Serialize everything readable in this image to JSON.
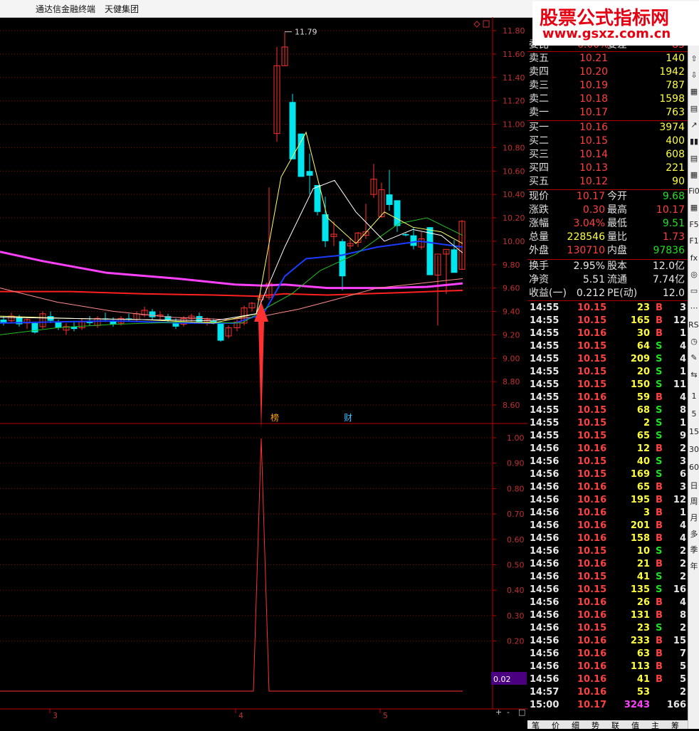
{
  "window": {
    "app_title": "通达信金融终端",
    "stock_name": "天健集团"
  },
  "watermark": {
    "line1": "股票公式指标网",
    "line2": "www.gsxz.com.cn"
  },
  "chart": {
    "high_marker": "11.79",
    "price_axis": [
      "11.80",
      "11.60",
      "11.40",
      "11.20",
      "11.00",
      "10.80",
      "10.60",
      "10.40",
      "10.20",
      "10.00",
      "9.80",
      "9.60",
      "9.40",
      "9.20",
      "9.00",
      "8.80",
      "8.60"
    ],
    "indicator_axis": [
      "1.00",
      "0.90",
      "0.80",
      "0.70",
      "0.60",
      "0.50",
      "0.40",
      "0.30",
      "0.20"
    ],
    "indicator_value": "0.02",
    "event_marks": [
      "榜",
      "财"
    ],
    "date_labels": [
      "3",
      "4",
      "5"
    ],
    "zoom_buttons": [
      "+",
      "-",
      "□"
    ],
    "colors": {
      "up": "#ff3030",
      "down": "#00e5ee",
      "grid": "#8b0000",
      "ma_long": "#ff40ff",
      "ma_blue": "#1a3cff"
    }
  },
  "quote": {
    "header_label": "委比",
    "header_value": "6.00%",
    "header_label2": "委差",
    "header_value2": "85",
    "asks": [
      {
        "label": "卖五",
        "price": "10.21",
        "vol": "140"
      },
      {
        "label": "卖四",
        "price": "10.20",
        "vol": "1942"
      },
      {
        "label": "卖三",
        "price": "10.19",
        "vol": "787"
      },
      {
        "label": "卖二",
        "price": "10.18",
        "vol": "1598"
      },
      {
        "label": "卖一",
        "price": "10.17",
        "vol": "763"
      }
    ],
    "bids": [
      {
        "label": "买一",
        "price": "10.16",
        "vol": "3974"
      },
      {
        "label": "买二",
        "price": "10.15",
        "vol": "400"
      },
      {
        "label": "买三",
        "price": "10.14",
        "vol": "608"
      },
      {
        "label": "买四",
        "price": "10.13",
        "vol": "221"
      },
      {
        "label": "买五",
        "price": "10.12",
        "vol": "90"
      }
    ],
    "stats": [
      {
        "l1": "现价",
        "v1": "10.17",
        "c1": "red",
        "l2": "今开",
        "v2": "9.68",
        "c2": "grn"
      },
      {
        "l1": "涨跌",
        "v1": "0.30",
        "c1": "red",
        "l2": "最高",
        "v2": "10.17",
        "c2": "red"
      },
      {
        "l1": "涨幅",
        "v1": "3.04%",
        "c1": "red",
        "l2": "最低",
        "v2": "9.51",
        "c2": "grn"
      },
      {
        "l1": "总量",
        "v1": "228546",
        "c1": "yel",
        "l2": "量比",
        "v2": "1.73",
        "c2": "red"
      },
      {
        "l1": "外盘",
        "v1": "130710",
        "c1": "red",
        "l2": "内盘",
        "v2": "97836",
        "c2": "grn"
      }
    ],
    "stats2": [
      {
        "l1": "换手",
        "v1": "2.95%",
        "l2": "股本",
        "v2": "12.0亿"
      },
      {
        "l1": "净资",
        "v1": "5.51",
        "l2": "流通",
        "v2": "7.74亿"
      },
      {
        "l1": "收益(一)",
        "v1": "0.212",
        "l2": "PE(动)",
        "v2": "12.0"
      }
    ],
    "ticks": [
      {
        "t": "14:55",
        "p": "10.15",
        "v": "23",
        "d": "B",
        "n": "3",
        "pc": "red"
      },
      {
        "t": "14:55",
        "p": "10.15",
        "v": "165",
        "d": "B",
        "n": "12",
        "pc": "red"
      },
      {
        "t": "14:55",
        "p": "10.16",
        "v": "30",
        "d": "B",
        "n": "1",
        "pc": "red"
      },
      {
        "t": "14:55",
        "p": "10.15",
        "v": "64",
        "d": "S",
        "n": "4",
        "pc": "red"
      },
      {
        "t": "14:55",
        "p": "10.15",
        "v": "209",
        "d": "S",
        "n": "4",
        "pc": "red"
      },
      {
        "t": "14:55",
        "p": "10.15",
        "v": "20",
        "d": "S",
        "n": "1",
        "pc": "red"
      },
      {
        "t": "14:55",
        "p": "10.15",
        "v": "150",
        "d": "S",
        "n": "11",
        "pc": "red"
      },
      {
        "t": "14:55",
        "p": "10.16",
        "v": "59",
        "d": "B",
        "n": "4",
        "pc": "red"
      },
      {
        "t": "14:55",
        "p": "10.15",
        "v": "68",
        "d": "S",
        "n": "8",
        "pc": "red"
      },
      {
        "t": "14:55",
        "p": "10.15",
        "v": "2",
        "d": "S",
        "n": "1",
        "pc": "red"
      },
      {
        "t": "14:55",
        "p": "10.15",
        "v": "65",
        "d": "S",
        "n": "9",
        "pc": "red"
      },
      {
        "t": "14:56",
        "p": "10.16",
        "v": "12",
        "d": "B",
        "n": "2",
        "pc": "red"
      },
      {
        "t": "14:56",
        "p": "10.15",
        "v": "40",
        "d": "S",
        "n": "3",
        "pc": "red"
      },
      {
        "t": "14:56",
        "p": "10.15",
        "v": "169",
        "d": "S",
        "n": "6",
        "pc": "red"
      },
      {
        "t": "14:56",
        "p": "10.16",
        "v": "65",
        "d": "B",
        "n": "3",
        "pc": "red"
      },
      {
        "t": "14:56",
        "p": "10.16",
        "v": "195",
        "d": "B",
        "n": "12",
        "pc": "red"
      },
      {
        "t": "14:56",
        "p": "10.16",
        "v": "3",
        "d": "B",
        "n": "1",
        "pc": "red"
      },
      {
        "t": "14:56",
        "p": "10.16",
        "v": "201",
        "d": "B",
        "n": "4",
        "pc": "red"
      },
      {
        "t": "14:56",
        "p": "10.16",
        "v": "158",
        "d": "B",
        "n": "4",
        "pc": "red"
      },
      {
        "t": "14:56",
        "p": "10.15",
        "v": "10",
        "d": "S",
        "n": "2",
        "pc": "red"
      },
      {
        "t": "14:56",
        "p": "10.16",
        "v": "21",
        "d": "B",
        "n": "2",
        "pc": "red"
      },
      {
        "t": "14:56",
        "p": "10.15",
        "v": "41",
        "d": "S",
        "n": "2",
        "pc": "red"
      },
      {
        "t": "14:56",
        "p": "10.15",
        "v": "135",
        "d": "S",
        "n": "16",
        "pc": "red"
      },
      {
        "t": "14:56",
        "p": "10.16",
        "v": "26",
        "d": "B",
        "n": "4",
        "pc": "red"
      },
      {
        "t": "14:56",
        "p": "10.16",
        "v": "131",
        "d": "B",
        "n": "8",
        "pc": "red"
      },
      {
        "t": "14:56",
        "p": "10.15",
        "v": "23",
        "d": "S",
        "n": "2",
        "pc": "red"
      },
      {
        "t": "14:56",
        "p": "10.16",
        "v": "233",
        "d": "B",
        "n": "15",
        "pc": "red"
      },
      {
        "t": "14:56",
        "p": "10.16",
        "v": "63",
        "d": "B",
        "n": "7",
        "pc": "red"
      },
      {
        "t": "14:56",
        "p": "10.16",
        "v": "113",
        "d": "B",
        "n": "5",
        "pc": "red"
      },
      {
        "t": "14:56",
        "p": "10.16",
        "v": "41",
        "d": "B",
        "n": "5",
        "pc": "red"
      },
      {
        "t": "14:57",
        "p": "10.16",
        "v": "53",
        "d": "",
        "n": "2",
        "pc": "red"
      },
      {
        "t": "15:00",
        "p": "10.17",
        "v": "3243",
        "d": "",
        "n": "166",
        "pc": "red",
        "vc": "mag"
      }
    ],
    "bottom_tabs": [
      "笔",
      "价",
      "细",
      "势",
      "联",
      "值",
      "主",
      "筹"
    ]
  },
  "toolbar": {
    "items": [
      "□",
      "⇧",
      "⇩",
      "▦",
      "▤",
      "↗",
      "▮▮",
      "▤",
      "▦",
      "Fi0",
      "▦",
      "F5",
      "F1",
      "fx",
      "◎",
      "▭",
      "⋯",
      "RSI",
      "◷",
      "✎",
      "⇆",
      "1",
      "5",
      "15",
      "30",
      "60",
      "日",
      "周",
      "月",
      "多",
      "季",
      "年"
    ]
  }
}
